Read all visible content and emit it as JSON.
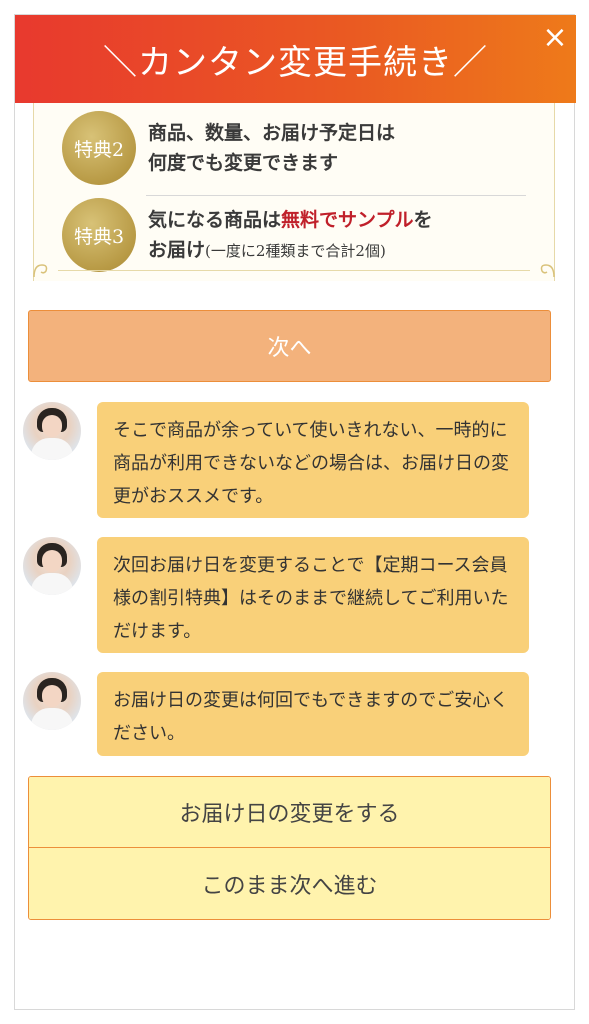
{
  "header": {
    "title": "＼カンタン変更手続き／",
    "close_label": "×"
  },
  "benefits": [
    {
      "badge": "特典2",
      "line1": "商品、数量、お届け予定日は",
      "line2": "何度でも変更できます"
    },
    {
      "badge": "特典3",
      "line1_pre": "気になる商品は",
      "line1_red": "無料でサンプル",
      "line1_post": "を",
      "line2": "お届け",
      "line2_small": "(一度に2種類まで合計2個)"
    }
  ],
  "next_button": {
    "label": "次へ"
  },
  "messages": [
    {
      "text": "そこで商品が余っていて使いきれない、一時的に商品が利用できないなどの場合は、お届け日の変更がおススメです。"
    },
    {
      "text": "次回お届け日を変更することで【定期コース会員様の割引特典】はそのままで継続してご利用いただけます。"
    },
    {
      "text": "お届け日の変更は何回でもできますのでご安心ください。"
    }
  ],
  "actions": {
    "change_date": "お届け日の変更をする",
    "continue": "このまま次へ進む"
  },
  "colors": {
    "header_start": "#e8392e",
    "header_end": "#ee7a1a",
    "next_button": "#f3b27c",
    "bubble": "#f9d079",
    "action_button": "#fff3ad",
    "accent_border": "#ec8e3a",
    "gold_badge": "#b89a45",
    "red_text": "#c0202a"
  }
}
